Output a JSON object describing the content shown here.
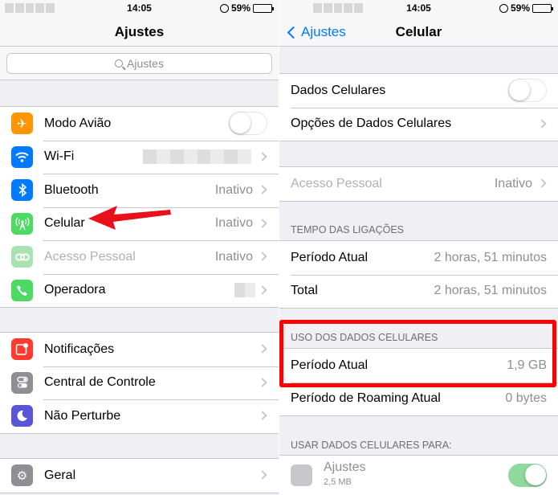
{
  "left": {
    "status": {
      "time": "14:05",
      "battery": "59%"
    },
    "nav_title": "Ajustes",
    "search_placeholder": "Ajustes",
    "group1": [
      {
        "label": "Modo Avião",
        "icon": "airplane-icon",
        "color": "#ff9500",
        "control": "toggle-off"
      },
      {
        "label": "Wi-Fi",
        "icon": "wifi-icon",
        "color": "#007aff",
        "value": ""
      },
      {
        "label": "Bluetooth",
        "icon": "bluetooth-icon",
        "color": "#007aff",
        "value": "Inativo"
      },
      {
        "label": "Celular",
        "icon": "antenna-icon",
        "color": "#4cd964",
        "value": "Inativo"
      },
      {
        "label": "Acesso Pessoal",
        "icon": "link-icon",
        "color": "#a8e2b2",
        "value": "Inativo"
      },
      {
        "label": "Operadora",
        "icon": "phone-icon",
        "color": "#4cd964",
        "value": ""
      }
    ],
    "group2": [
      {
        "label": "Notificações",
        "icon": "notifications-icon",
        "color": "#ff3b30"
      },
      {
        "label": "Central de Controle",
        "icon": "control-center-icon",
        "color": "#8e8e93"
      },
      {
        "label": "Não Perturbe",
        "icon": "moon-icon",
        "color": "#5856d6"
      }
    ],
    "group3": [
      {
        "label": "Geral",
        "icon": "gear-icon",
        "color": "#8e8e93"
      }
    ]
  },
  "right": {
    "status": {
      "time": "14:05",
      "battery": "59%"
    },
    "back_label": "Ajustes",
    "nav_title": "Celular",
    "group1": [
      {
        "label": "Dados Celulares",
        "control": "toggle-off"
      },
      {
        "label": "Opções de Dados Celulares"
      }
    ],
    "group2": [
      {
        "label": "Acesso Pessoal",
        "value": "Inativo"
      }
    ],
    "section_calls": "TEMPO DAS LIGAÇÕES",
    "calls": [
      {
        "label": "Período Atual",
        "value": "2 horas, 51 minutos"
      },
      {
        "label": "Total",
        "value": "2 horas, 51 minutos"
      }
    ],
    "section_data": "USO DOS DADOS CELULARES",
    "data_usage": [
      {
        "label": "Período Atual",
        "value": "1,9 GB"
      },
      {
        "label": "Período de Roaming Atual",
        "value": "0 bytes"
      }
    ],
    "section_apps": "USAR DADOS CELULARES PARA:",
    "apps": [
      {
        "label": "Ajustes",
        "sub": "2,5 MB",
        "control": "toggle-on"
      }
    ]
  },
  "colors": {
    "highlight": "#ff0000",
    "arrow": "#e8101a",
    "accent": "#007aff"
  }
}
